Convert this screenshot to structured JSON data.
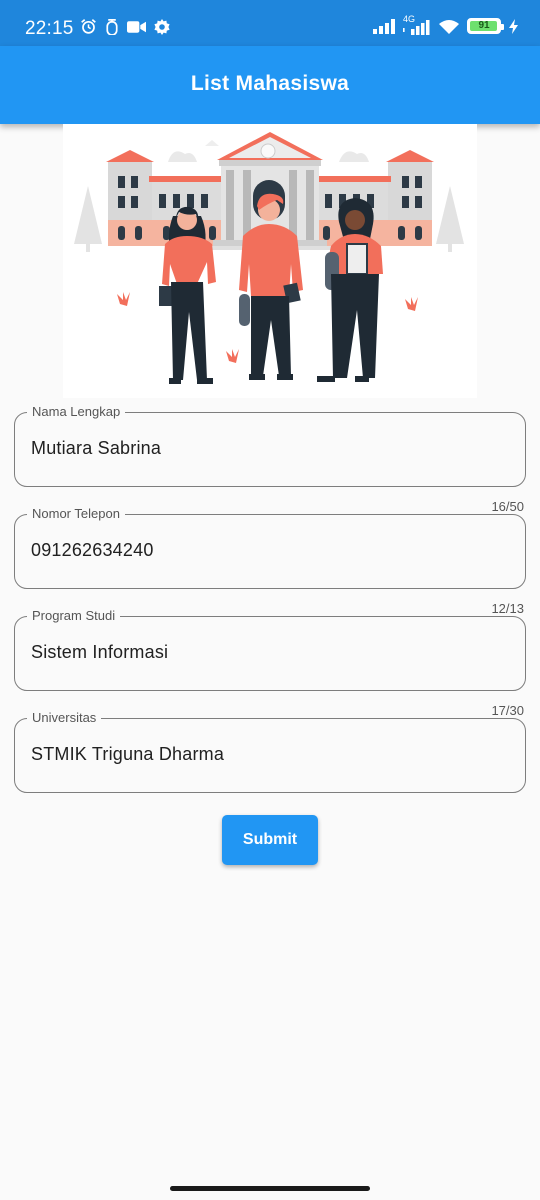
{
  "status_bar": {
    "time": "22:15",
    "network_type": "4G",
    "battery_level": "91",
    "left_icons": [
      "alarm-icon",
      "notification-icon",
      "video-camera-icon",
      "gear-icon"
    ],
    "right_icons": [
      "signal-icon",
      "signal-4g-icon",
      "wifi-icon",
      "battery-icon",
      "charging-icon"
    ]
  },
  "app_bar": {
    "title": "List Mahasiswa"
  },
  "form": {
    "fields": [
      {
        "label": "Nama Lengkap",
        "value": "Mutiara Sabrina",
        "counter": "16/50"
      },
      {
        "label": "Nomor Telepon",
        "value": "091262634240",
        "counter": "12/13"
      },
      {
        "label": "Program Studi",
        "value": "Sistem Informasi",
        "counter": "17/30"
      },
      {
        "label": "Universitas",
        "value": "STMIK Triguna Dharma"
      }
    ]
  },
  "submit_label": "Submit",
  "colors": {
    "primary": "#2196f3",
    "status_bar": "#1f86dc",
    "accent_illustration": "#f26f5b"
  }
}
